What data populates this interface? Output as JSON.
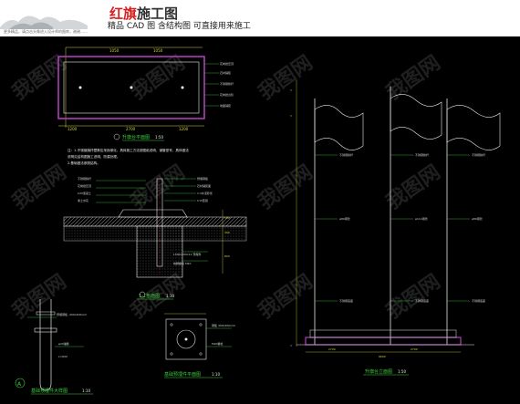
{
  "header": {
    "title_red": "红旗",
    "title_dark": "施工图",
    "subtitle": "精品 CAD 图   含结构图  可直接用来施工",
    "hint": "更多精品，请点击头像进入设计师的图库，谢谢……"
  },
  "drawings": {
    "plan_title": "升旗台平面图",
    "plan_scale": "1:50",
    "section_title": "1-1剖面图",
    "section_scale": "1:10",
    "detail_marker": "A",
    "detail_title": "基础预埋件大样图",
    "detail_scale": "1:10",
    "embed_title": "基础预埋件平面图",
    "embed_scale": "1:10",
    "elev_title": "升旗台立面图",
    "elev_scale": "1:50",
    "notes_line1": "注：1.不锈钢旗杆壁厚应采用绿化，具体施工方法按图纸说明，钢管型号，具体做法",
    "notes_line2": "   说明见结构图施工说明，防腐处理。",
    "notes_line3": "   2.基础做法参照结构。",
    "dims": {
      "d1": "1050",
      "d2": "1050",
      "d3": "2700",
      "d4": "1200"
    }
  },
  "colors": {
    "bg": "#000000",
    "frame": "#b23bbf",
    "line_green": "#3fcf3f",
    "line_yellow": "#d8d838",
    "line_white": "#e8e8e8",
    "line_cyan": "#3ccfcf",
    "line_red": "#d83030",
    "title_red": "#d8201e"
  },
  "watermark": "我图网"
}
